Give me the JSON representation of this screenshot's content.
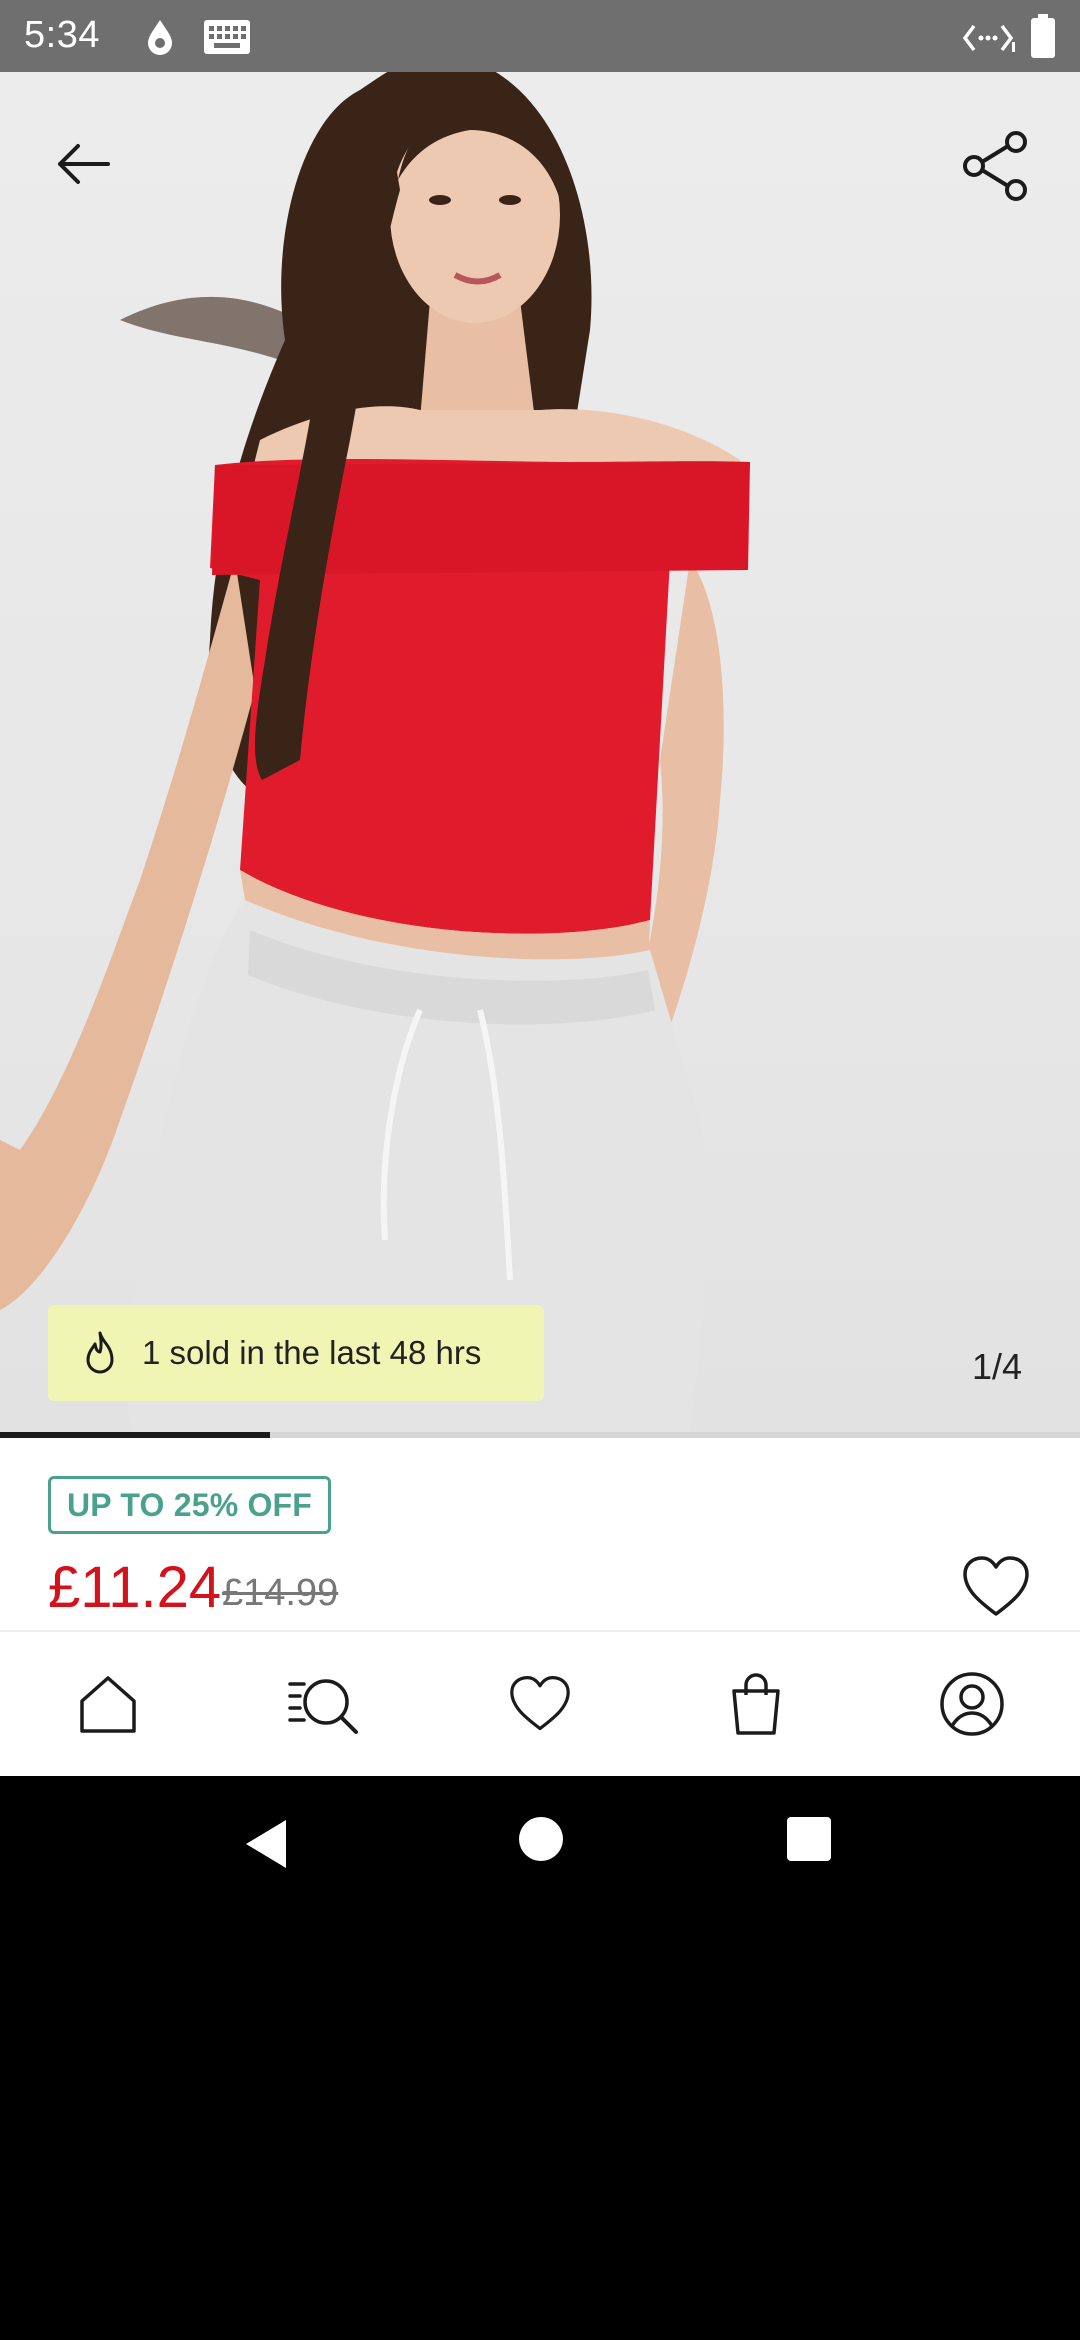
{
  "status_bar": {
    "time": "5:34",
    "icons": [
      "water-drop-icon",
      "keyboard-icon",
      "code-arrows-icon",
      "battery-icon"
    ]
  },
  "product_image": {
    "back_icon": "arrow-left-icon",
    "share_icon": "share-icon",
    "sold_text": "1 sold in the last 48 hrs",
    "sold_icon": "flame-icon",
    "image_counter": "1/4",
    "carousel_progress": 0.25
  },
  "pricing": {
    "discount_label": "UP TO 25% OFF",
    "current_price": "£11.24",
    "original_price": "£14.99",
    "wishlist_icon": "heart-icon"
  },
  "bottom_nav": {
    "items": [
      {
        "name": "home",
        "icon": "home-icon"
      },
      {
        "name": "search",
        "icon": "search-list-icon"
      },
      {
        "name": "wishlist",
        "icon": "heart-icon"
      },
      {
        "name": "bag",
        "icon": "shopping-bag-icon"
      },
      {
        "name": "account",
        "icon": "user-circle-icon"
      }
    ]
  },
  "colors": {
    "price_red": "#d3121b",
    "discount_green": "#4aa18e",
    "badge_yellow": "#f1f5b4"
  }
}
